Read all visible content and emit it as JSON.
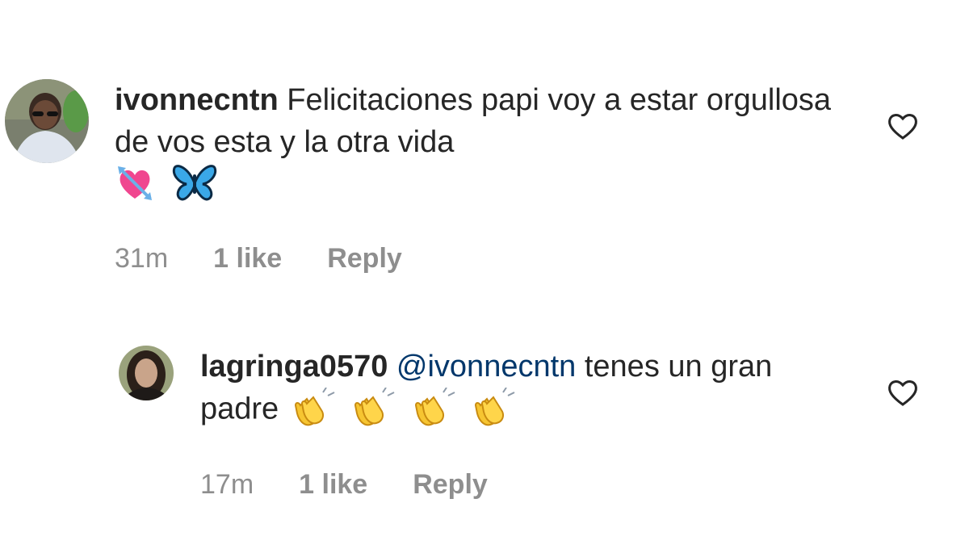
{
  "comments": [
    {
      "username": "ivonnecntn",
      "text": "Felicitaciones papi voy a estar orgullosa de vos esta y la otra vida",
      "emojis": [
        "💘",
        "🦋"
      ],
      "time": "31m",
      "likes": "1 like",
      "reply": "Reply",
      "heart_icon": "heart-outline-icon"
    },
    {
      "username": "lagringa0570",
      "mention": "@ivonnecntn",
      "text": "tenes un gran padre",
      "emojis": [
        "👏",
        "👏",
        "👏",
        "👏"
      ],
      "time": "17m",
      "likes": "1 like",
      "reply": "Reply",
      "heart_icon": "heart-outline-icon"
    }
  ],
  "colors": {
    "text": "#262626",
    "meta": "#8e8e8e",
    "mention": "#00376b",
    "background": "#ffffff"
  }
}
